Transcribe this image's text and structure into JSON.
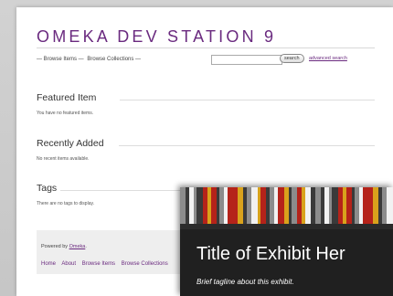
{
  "site": {
    "title": "OMEKA DEV STATION 9"
  },
  "topnav": {
    "items": [
      "— Browse Items —",
      "Browse Collections —"
    ]
  },
  "search": {
    "button": "search",
    "advanced": "advanced search",
    "value": ""
  },
  "featured": {
    "heading": "Featured Item",
    "note": "You have no featured items."
  },
  "recent": {
    "heading": "Recently Added",
    "note": "No recent items available."
  },
  "tags": {
    "heading": "Tags",
    "note": "There are no tags to display."
  },
  "footer": {
    "powered_prefix": "Powered by",
    "powered_link": "Omeka",
    "powered_suffix": ".",
    "nav": [
      "Home",
      "About",
      "Browse Items",
      "Browse Collections"
    ]
  },
  "exhibit": {
    "title": "Title of Exhibit Her",
    "tagline": "Brief tagline about this exhibit.",
    "colors": {
      "red": "#b5231a",
      "gold": "#d9a21c",
      "gray": "#8c8c8c",
      "dark": "#3a3a3a",
      "white": "#f2f2f2"
    }
  },
  "colors": {
    "accent": "#6a2a7f"
  }
}
